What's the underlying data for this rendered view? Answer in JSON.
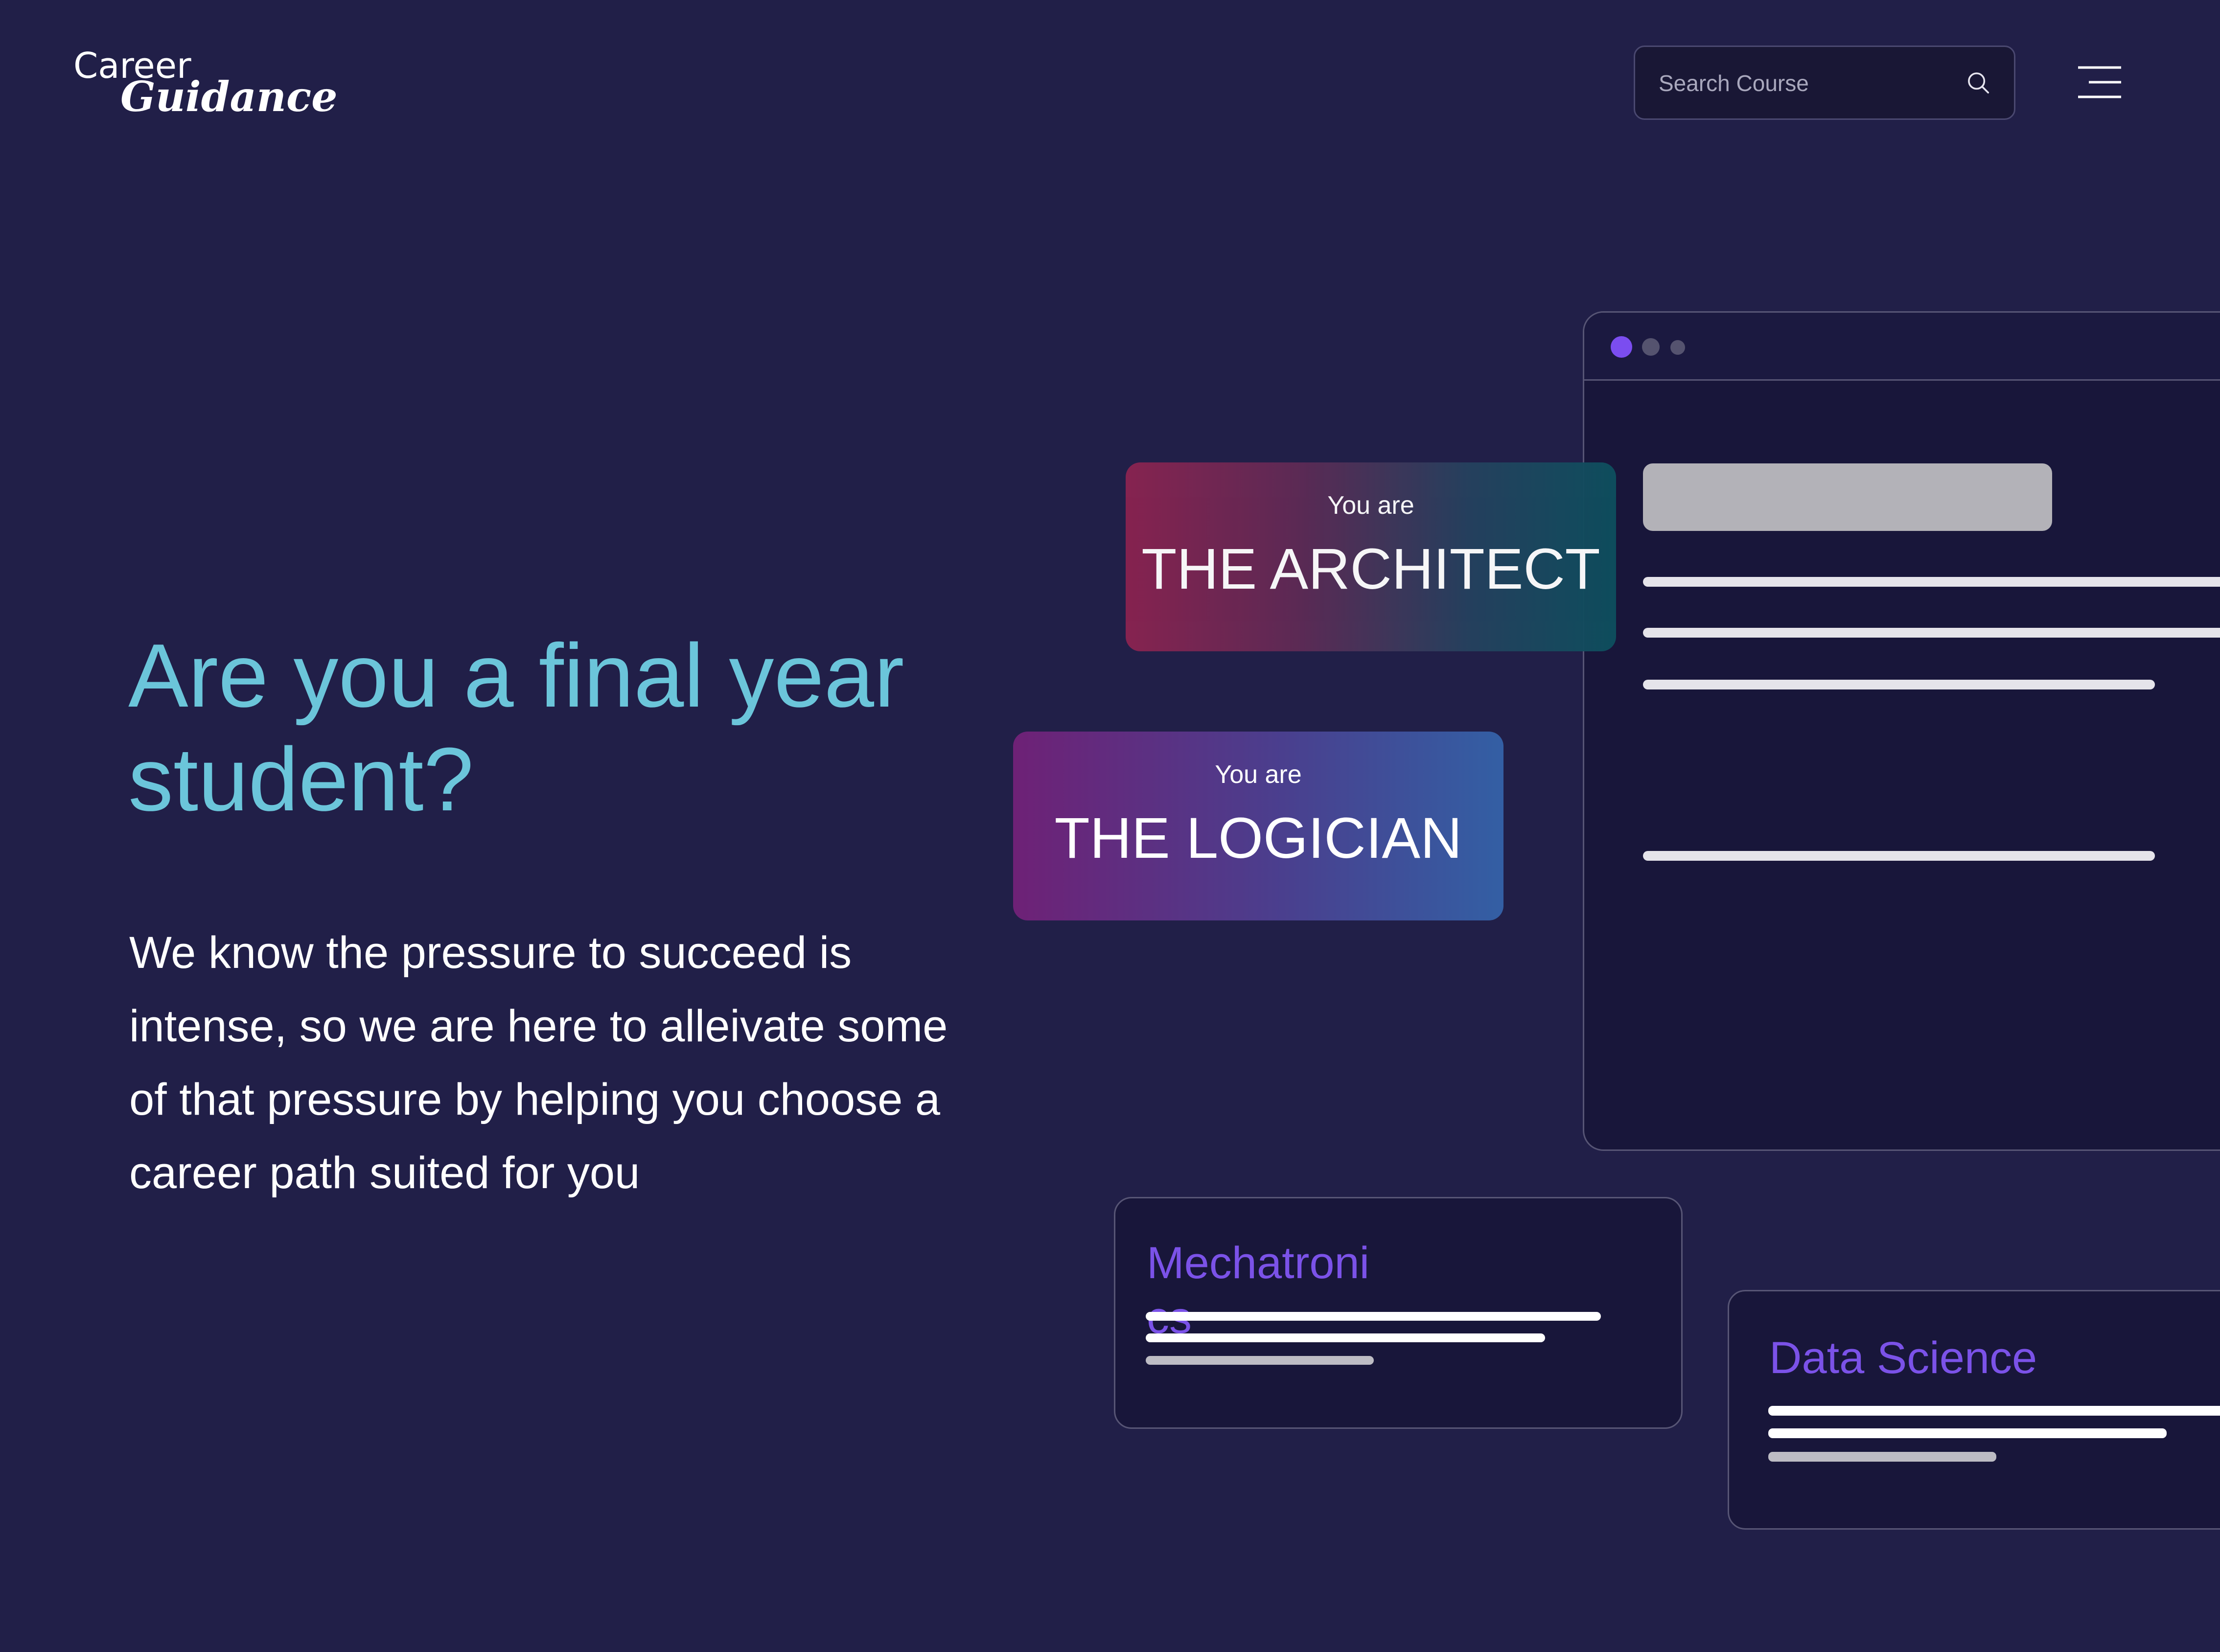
{
  "header": {
    "logo_line1": "Career",
    "logo_line2": "Guidance",
    "search_placeholder": "Search Course"
  },
  "hero": {
    "title_line1": "Are you a final year",
    "title_line2": "student?",
    "body": "We know the pressure to succeed is intense, so we are here to alleivate some of that pressure by helping you choose a career path suited for you"
  },
  "personality_cards": [
    {
      "small": "You are",
      "big": "THE ARCHITECT"
    },
    {
      "small": "You are",
      "big": "THE LOGICIAN"
    }
  ],
  "courses": [
    {
      "title": "Mechatronics"
    },
    {
      "title": "Data Science"
    }
  ],
  "colors": {
    "background": "#211f48",
    "hero_title": "#6bc5da",
    "course_title": "#7b52e8",
    "browser_dot_active": "#7b4df0"
  },
  "icons": [
    "search-icon",
    "hamburger-menu-icon"
  ]
}
